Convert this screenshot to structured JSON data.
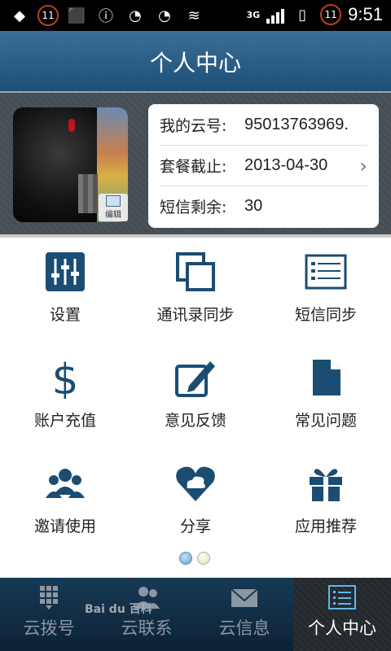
{
  "status_bar": {
    "left_badge": "11",
    "right_badge": "11",
    "network": "3G",
    "time": "9:51"
  },
  "header": {
    "title": "个人中心"
  },
  "profile": {
    "edit_label": "编辑",
    "rows": [
      {
        "label": "我的云号:",
        "value": "95013763969."
      },
      {
        "label": "套餐截止:",
        "value": "2013-04-30"
      },
      {
        "label": "短信剩余:",
        "value": "30"
      }
    ]
  },
  "grid": {
    "items": [
      {
        "label": "设置",
        "icon": "sliders-icon"
      },
      {
        "label": "通讯录同步",
        "icon": "copy-icon"
      },
      {
        "label": "短信同步",
        "icon": "list-icon"
      },
      {
        "label": "账户充值",
        "icon": "dollar-icon"
      },
      {
        "label": "意见反馈",
        "icon": "edit-pencil-icon"
      },
      {
        "label": "常见问题",
        "icon": "document-icon"
      },
      {
        "label": "邀请使用",
        "icon": "group-icon"
      },
      {
        "label": "分享",
        "icon": "heart-cloud-icon"
      },
      {
        "label": "应用推荐",
        "icon": "gift-icon"
      }
    ],
    "page_indicator": {
      "current": 1,
      "total": 2
    }
  },
  "tabs": {
    "items": [
      {
        "label": "云拨号",
        "icon": "dialpad-icon"
      },
      {
        "label": "云联系",
        "icon": "contacts-icon"
      },
      {
        "label": "云信息",
        "icon": "envelope-icon"
      },
      {
        "label": "个人中心",
        "icon": "profile-list-icon"
      }
    ],
    "active": "个人中心",
    "watermark": "Bai du 百科"
  }
}
